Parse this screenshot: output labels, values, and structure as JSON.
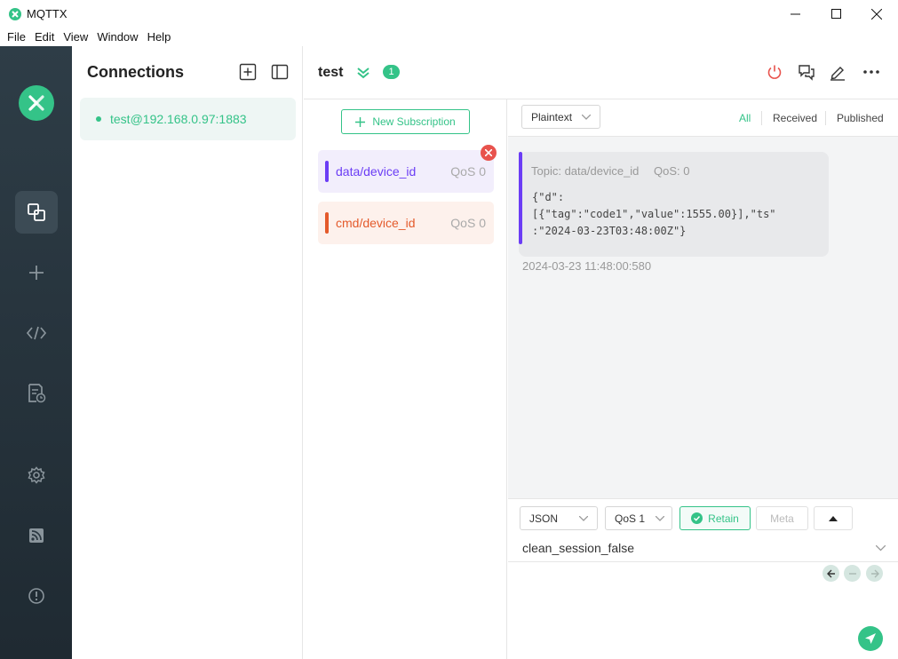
{
  "window": {
    "title": "MQTTX"
  },
  "menu": {
    "items": [
      "File",
      "Edit",
      "View",
      "Window",
      "Help"
    ]
  },
  "colors": {
    "accent": "#34c388",
    "sidebar": "#28353e",
    "danger": "#e8534d",
    "purple": "#6b3df5",
    "orange": "#e45a2b"
  },
  "sidebar": {
    "icons": [
      "connections-icon",
      "add-icon",
      "script-icon",
      "log-icon",
      "settings-icon",
      "feed-icon",
      "about-icon"
    ]
  },
  "connections": {
    "title": "Connections",
    "items": [
      {
        "name": "test@192.168.0.97:1883",
        "status": "connected"
      }
    ]
  },
  "header": {
    "name": "test",
    "unread_badge": "1"
  },
  "subscriptions": {
    "new_label": "New Subscription",
    "items": [
      {
        "topic": "data/device_id",
        "qos": "QoS 0",
        "color": "#6b3df5"
      },
      {
        "topic": "cmd/device_id",
        "qos": "QoS 0",
        "color": "#e45a2b"
      }
    ]
  },
  "messages": {
    "format": "Plaintext",
    "filters": [
      "All",
      "Received",
      "Published"
    ],
    "active_filter": "All",
    "items": [
      {
        "meta_topic": "Topic: data/device_id",
        "meta_qos": "QoS: 0",
        "payload": "{\"d\":\n[{\"tag\":\"code1\",\"value\":1555.00}],\"ts\"\n:\"2024-03-23T03:48:00Z\"}",
        "time": "2024-03-23 11:48:00:580"
      }
    ]
  },
  "publish": {
    "format": "JSON",
    "qos": "QoS 1",
    "retain_label": "Retain",
    "meta_label": "Meta",
    "topic": "clean_session_false"
  }
}
